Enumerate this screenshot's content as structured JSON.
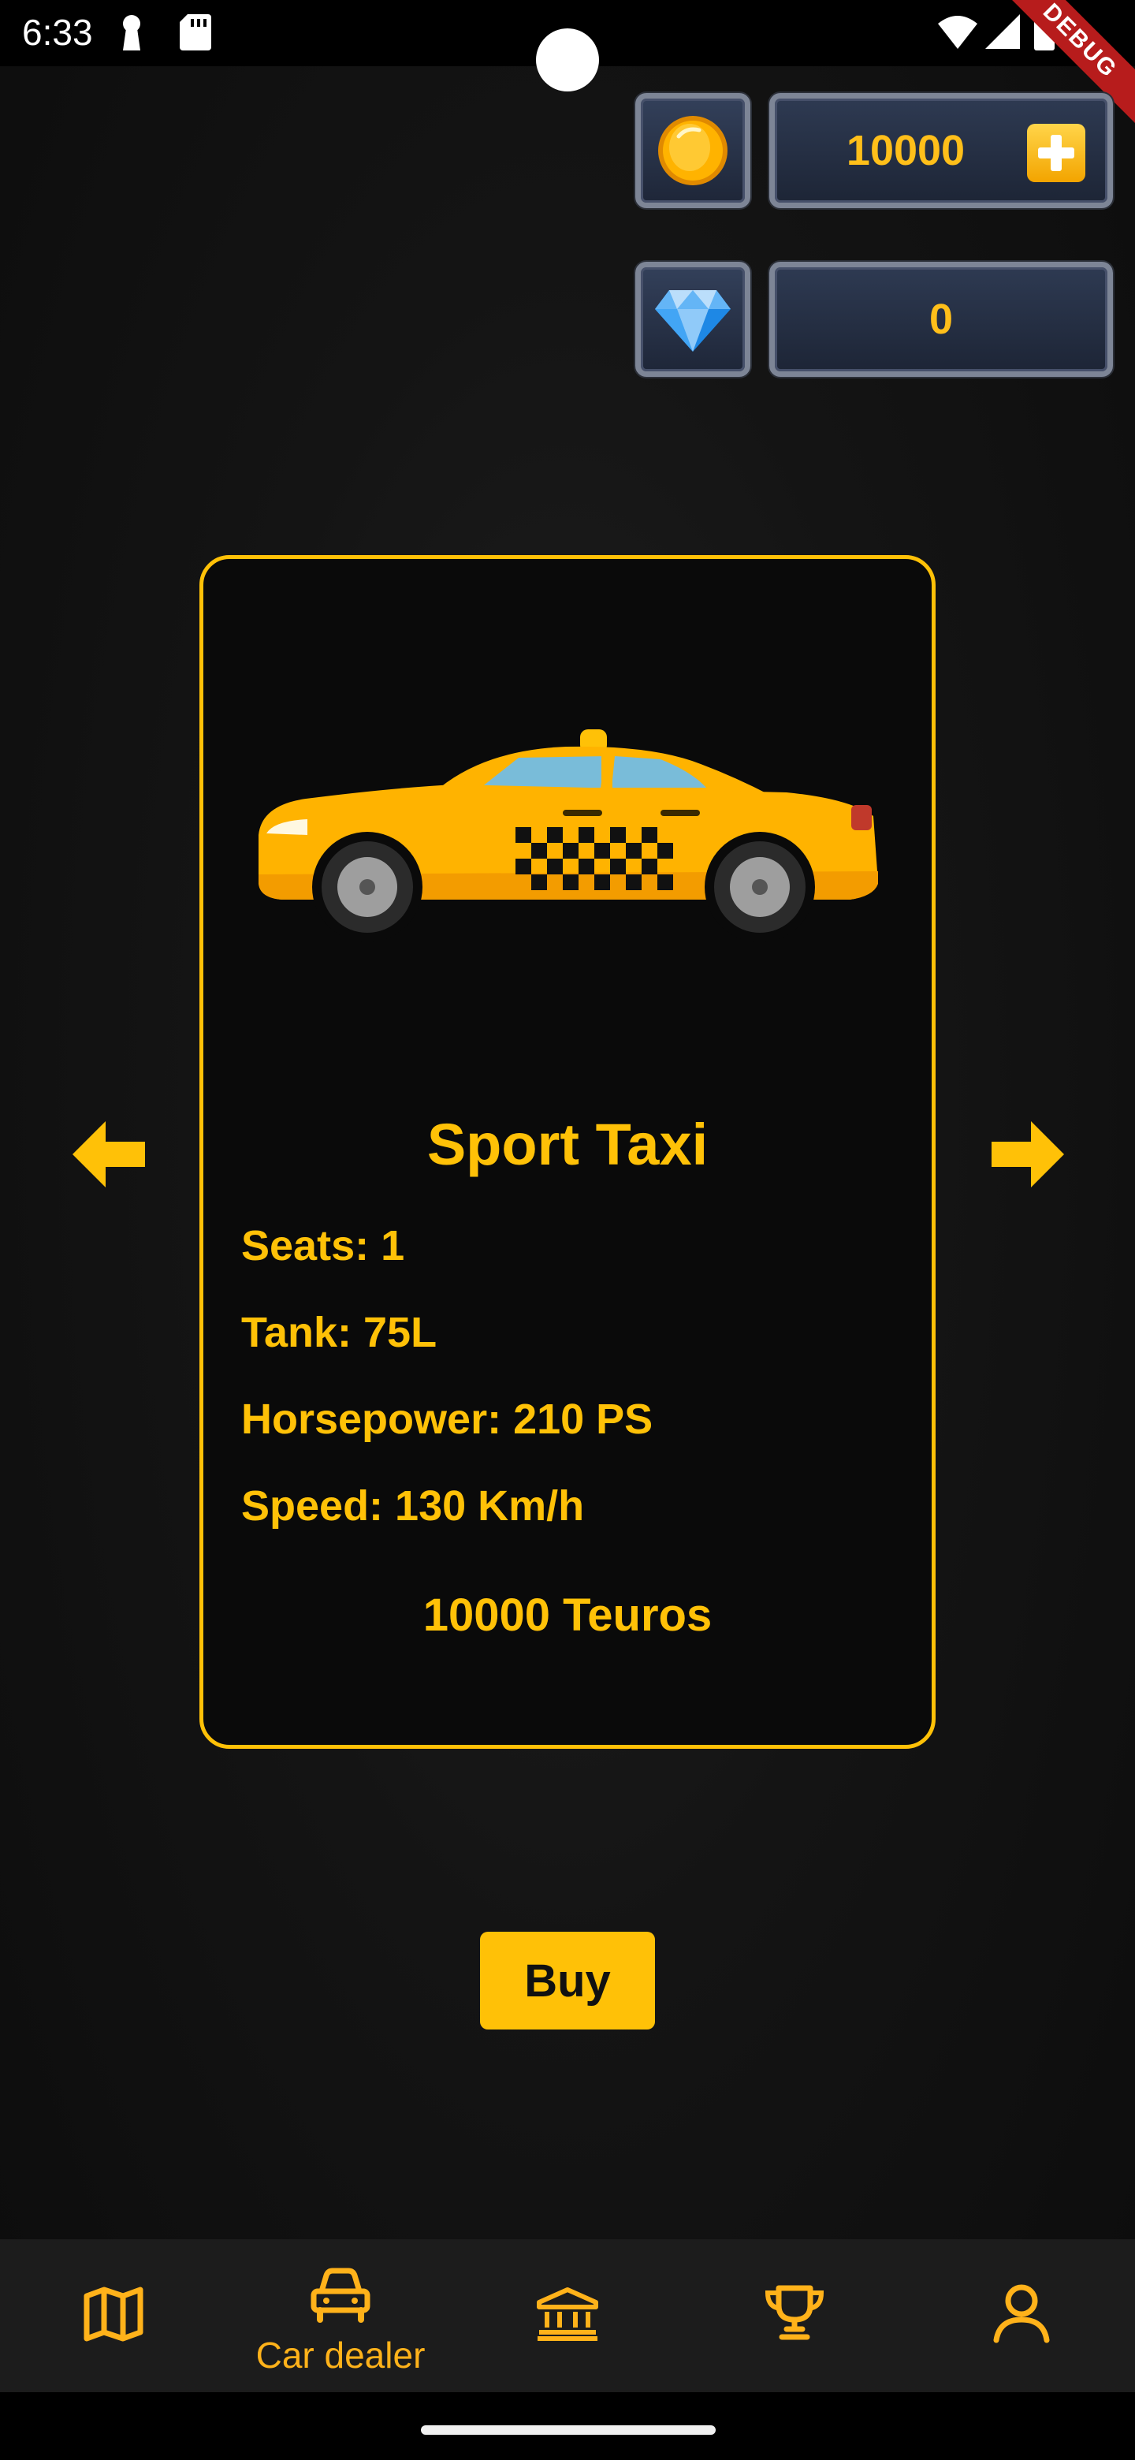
{
  "status_bar": {
    "time": "6:33",
    "debug_label": "DEBUG"
  },
  "currency": {
    "coins": {
      "value": "10000",
      "icon": "coin-icon"
    },
    "gems": {
      "value": "0",
      "icon": "diamond-icon"
    }
  },
  "car": {
    "name": "Sport Taxi",
    "specs": [
      "Seats: 1",
      "Tank: 75L",
      "Horsepower: 210 PS",
      "Speed: 130 Km/h"
    ],
    "price": "10000 Teuros"
  },
  "actions": {
    "buy_label": "Buy"
  },
  "bottom_nav": {
    "items": [
      {
        "icon": "map-icon",
        "label": ""
      },
      {
        "icon": "car-icon",
        "label": "Car dealer",
        "active": true
      },
      {
        "icon": "bank-icon",
        "label": ""
      },
      {
        "icon": "trophy-icon",
        "label": ""
      },
      {
        "icon": "profile-icon",
        "label": ""
      }
    ]
  },
  "colors": {
    "accent": "#ffc107",
    "nav_accent": "#ffb21a",
    "background": "#141414"
  }
}
